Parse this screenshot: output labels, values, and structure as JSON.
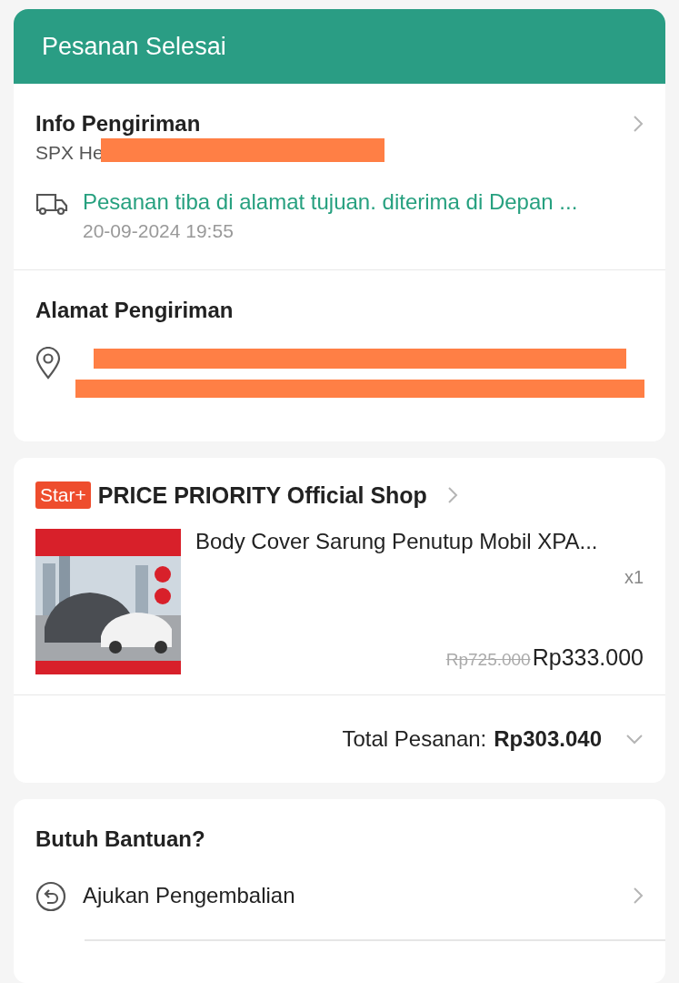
{
  "header": {
    "title": "Pesanan Selesai"
  },
  "shipping_info": {
    "title": "Info Pengiriman",
    "courier": "SPX He",
    "courier_redacted": true,
    "status": "Pesanan tiba di alamat tujuan. diterima di Depan ...",
    "time": "20-09-2024 19:55"
  },
  "address": {
    "title": "Alamat Pengiriman",
    "redacted": true
  },
  "order": {
    "badge": "Star+",
    "shop": "PRICE PRIORITY Official Shop",
    "product": {
      "name": "Body Cover Sarung Penutup Mobil XPA...",
      "quantity": "x1",
      "original_price": "Rp725.000",
      "price": "Rp333.000"
    },
    "total_label": "Total Pesanan:",
    "total": "Rp303.040"
  },
  "help": {
    "title": "Butuh Bantuan?",
    "items": [
      {
        "label": "Ajukan Pengembalian"
      }
    ]
  }
}
